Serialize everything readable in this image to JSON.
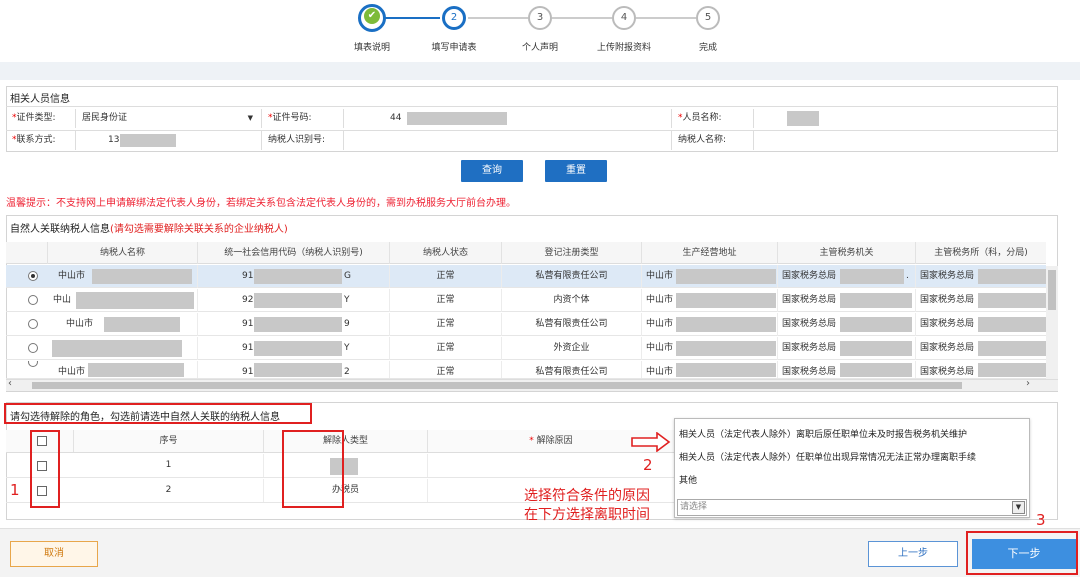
{
  "steps": [
    {
      "number": "✔",
      "label": "填表说明",
      "state": "done"
    },
    {
      "number": "2",
      "label": "填写申请表",
      "state": "active"
    },
    {
      "number": "3",
      "label": "个人声明",
      "state": "todo"
    },
    {
      "number": "4",
      "label": "上传附报资料",
      "state": "todo"
    },
    {
      "number": "5",
      "label": "完成",
      "state": "todo"
    }
  ],
  "person_info": {
    "title": "相关人员信息",
    "id_type_label": "证件类型:",
    "id_type_value": "居民身份证",
    "id_no_label": "证件号码:",
    "id_no_value": "44",
    "name_label": "人员名称:",
    "contact_label": "联系方式:",
    "contact_value": "13",
    "taxpayer_id_label": "纳税人识别号:",
    "taxpayer_name_label": "纳税人名称:",
    "required_mark": "*"
  },
  "buttons": {
    "query": "查询",
    "reset": "重置",
    "cancel": "取消",
    "prev": "上一步",
    "next": "下一步"
  },
  "warning": "温馨提示：不支持网上申请解绑法定代表人身份，若绑定关系包含法定代表人身份的，需到办税服务大厅前台办理。",
  "related": {
    "title": "自然人关联纳税人信息",
    "title_note": "(请勾选需要解除关联关系的企业纳税人)",
    "columns": [
      "纳税人名称",
      "统一社会信用代码（纳税人识别号)",
      "纳税人状态",
      "登记注册类型",
      "生产经营地址",
      "主管税务机关",
      "主管税务所（科，分局)"
    ],
    "rows": [
      {
        "name": "中山市",
        "code_prefix": "91",
        "code_suffix": "G",
        "status": "正常",
        "type": "私营有限责任公司",
        "addr": "中山市",
        "office": "国家税务总局",
        "office_suffix": ".",
        "branch": "国家税务总局",
        "selected": true
      },
      {
        "name": "中山",
        "code_prefix": "92",
        "code_suffix": "Y",
        "status": "正常",
        "type": "内资个体",
        "addr": "中山市",
        "office": "国家税务总局",
        "office_suffix": "",
        "branch": "国家税务总局",
        "selected": false
      },
      {
        "name": "中山市",
        "code_prefix": "91",
        "code_suffix": "9",
        "status": "正常",
        "type": "私营有限责任公司",
        "addr": "中山市",
        "office": "国家税务总局",
        "office_suffix": "",
        "branch": "国家税务总局",
        "selected": false
      },
      {
        "name": "",
        "code_prefix": "91",
        "code_suffix": "Y",
        "status": "正常",
        "type": "外资企业",
        "addr": "中山市",
        "office": "国家税务总局",
        "office_suffix": "",
        "branch": "国家税务总局",
        "selected": false
      },
      {
        "name": "中山市",
        "code_prefix": "91",
        "code_suffix": "2",
        "status": "正常",
        "type": "私营有限责任公司",
        "addr": "中山市",
        "office": "国家税务总局",
        "office_suffix": "",
        "branch": "国家税务总局",
        "selected": false
      }
    ]
  },
  "roles": {
    "title": "请勾选待解除的角色，勾选前请选中自然人关联的纳税人信息",
    "col_seq": "序号",
    "col_type": "解除人类型",
    "col_reason": "解除原因",
    "rows": [
      {
        "seq": "1",
        "type": ""
      },
      {
        "seq": "2",
        "type": "办税员"
      }
    ]
  },
  "reason_dropdown": {
    "options": [
      "相关人员（法定代表人除外）离职后原任职单位未及时报告税务机关维护",
      "相关人员（法定代表人除外）任职单位出现异常情况无法正常办理离职手续",
      "其他"
    ],
    "placeholder": "请选择"
  },
  "annotations": {
    "num1": "1",
    "num2": "2",
    "num3": "3",
    "instruction_line1": "选择符合条件的原因",
    "instruction_line2": "在下方选择离职时间"
  }
}
